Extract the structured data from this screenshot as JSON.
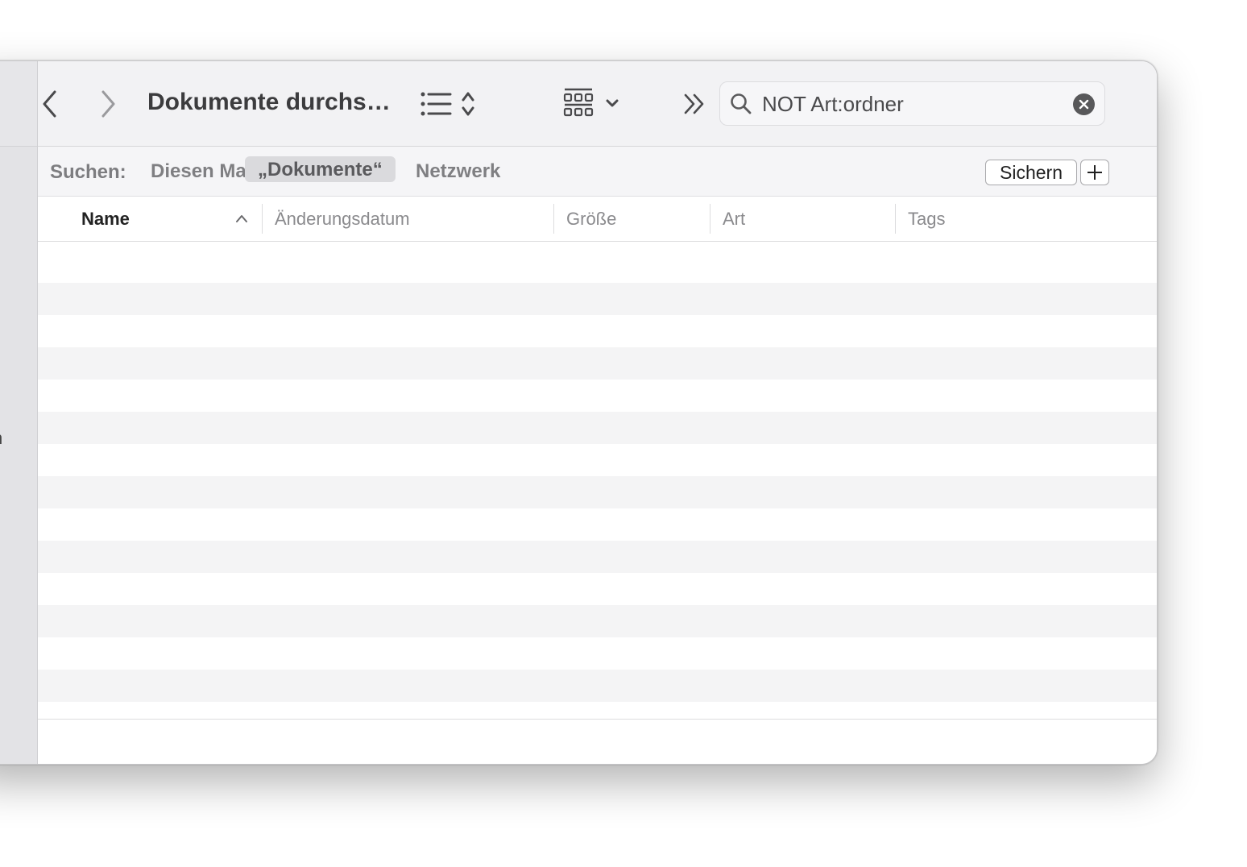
{
  "toolbar": {
    "title": "Dokumente durchs…",
    "search_value": "NOT Art:ordner"
  },
  "scope": {
    "label": "Suchen:",
    "options": [
      "Diesen Mac",
      "„Dokumente“",
      "Netzwerk"
    ],
    "selected": "„Dokumente“",
    "save_label": "Sichern"
  },
  "columns": [
    "Name",
    "Änderungsdatum",
    "Größe",
    "Art",
    "Tags"
  ],
  "sorted_column": "Name",
  "sidebar": {
    "clipped_glyphs": [
      ".",
      "n"
    ]
  },
  "icons": {
    "back": "chevron-left-icon",
    "forward": "chevron-right-icon",
    "view_mode": "list-view-icon",
    "group": "grid-group-icon",
    "more": "double-chevron-right-icon",
    "search": "magnifier-icon",
    "clear": "clear-circle-icon",
    "sort": "chevron-up-icon"
  },
  "colors": {
    "toolbar_bg": "#f2f2f4",
    "sidebar_bg": "#e3e3e6",
    "scope_active_bg": "#dadadd",
    "row_stripe": "#f4f4f5"
  }
}
